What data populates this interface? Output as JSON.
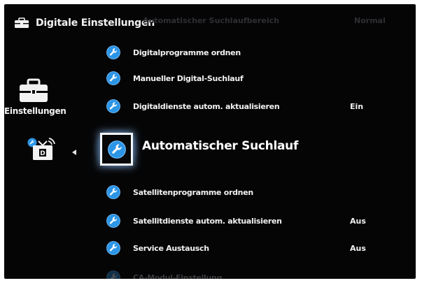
{
  "header": {
    "title": "Digitale Einstellungen",
    "icon": "toolbox-icon"
  },
  "faded_top": {
    "label": "Automatischer Suchlaufbereich",
    "value": "Normal"
  },
  "category": {
    "label": "Einstellungen",
    "icon": "toolbox-icon",
    "sub_icon": "digital-antenna-icon"
  },
  "menu": {
    "items": [
      {
        "label": "Digitalprogramme ordnen",
        "value": ""
      },
      {
        "label": "Manueller Digital-Suchlauf",
        "value": ""
      },
      {
        "label": "Digitaldienste autom. aktualisieren",
        "value": "Ein"
      }
    ],
    "selected": {
      "label": "Automatischer Suchlauf",
      "icon": "wrench-icon"
    },
    "items_after": [
      {
        "label": "Satellitenprogramme ordnen",
        "value": ""
      },
      {
        "label": "Satellitdienste autom. aktualisieren",
        "value": "Aus"
      },
      {
        "label": "Service Austausch",
        "value": "Aus"
      }
    ],
    "faded_bottom": {
      "label": "CA-Modul-Einstellung"
    }
  },
  "colors": {
    "background": "#050506",
    "icon_blue": "#2c95e6",
    "text": "#f1f1f1",
    "highlight": "#9fd0ff"
  }
}
